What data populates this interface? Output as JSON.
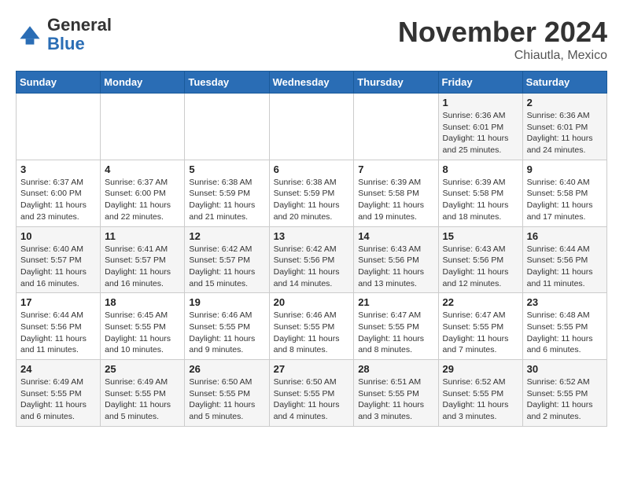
{
  "logo": {
    "general": "General",
    "blue": "Blue"
  },
  "header": {
    "month": "November 2024",
    "location": "Chiautla, Mexico"
  },
  "weekdays": [
    "Sunday",
    "Monday",
    "Tuesday",
    "Wednesday",
    "Thursday",
    "Friday",
    "Saturday"
  ],
  "weeks": [
    [
      {
        "day": "",
        "info": ""
      },
      {
        "day": "",
        "info": ""
      },
      {
        "day": "",
        "info": ""
      },
      {
        "day": "",
        "info": ""
      },
      {
        "day": "",
        "info": ""
      },
      {
        "day": "1",
        "info": "Sunrise: 6:36 AM\nSunset: 6:01 PM\nDaylight: 11 hours\nand 25 minutes."
      },
      {
        "day": "2",
        "info": "Sunrise: 6:36 AM\nSunset: 6:01 PM\nDaylight: 11 hours\nand 24 minutes."
      }
    ],
    [
      {
        "day": "3",
        "info": "Sunrise: 6:37 AM\nSunset: 6:00 PM\nDaylight: 11 hours\nand 23 minutes."
      },
      {
        "day": "4",
        "info": "Sunrise: 6:37 AM\nSunset: 6:00 PM\nDaylight: 11 hours\nand 22 minutes."
      },
      {
        "day": "5",
        "info": "Sunrise: 6:38 AM\nSunset: 5:59 PM\nDaylight: 11 hours\nand 21 minutes."
      },
      {
        "day": "6",
        "info": "Sunrise: 6:38 AM\nSunset: 5:59 PM\nDaylight: 11 hours\nand 20 minutes."
      },
      {
        "day": "7",
        "info": "Sunrise: 6:39 AM\nSunset: 5:58 PM\nDaylight: 11 hours\nand 19 minutes."
      },
      {
        "day": "8",
        "info": "Sunrise: 6:39 AM\nSunset: 5:58 PM\nDaylight: 11 hours\nand 18 minutes."
      },
      {
        "day": "9",
        "info": "Sunrise: 6:40 AM\nSunset: 5:58 PM\nDaylight: 11 hours\nand 17 minutes."
      }
    ],
    [
      {
        "day": "10",
        "info": "Sunrise: 6:40 AM\nSunset: 5:57 PM\nDaylight: 11 hours\nand 16 minutes."
      },
      {
        "day": "11",
        "info": "Sunrise: 6:41 AM\nSunset: 5:57 PM\nDaylight: 11 hours\nand 16 minutes."
      },
      {
        "day": "12",
        "info": "Sunrise: 6:42 AM\nSunset: 5:57 PM\nDaylight: 11 hours\nand 15 minutes."
      },
      {
        "day": "13",
        "info": "Sunrise: 6:42 AM\nSunset: 5:56 PM\nDaylight: 11 hours\nand 14 minutes."
      },
      {
        "day": "14",
        "info": "Sunrise: 6:43 AM\nSunset: 5:56 PM\nDaylight: 11 hours\nand 13 minutes."
      },
      {
        "day": "15",
        "info": "Sunrise: 6:43 AM\nSunset: 5:56 PM\nDaylight: 11 hours\nand 12 minutes."
      },
      {
        "day": "16",
        "info": "Sunrise: 6:44 AM\nSunset: 5:56 PM\nDaylight: 11 hours\nand 11 minutes."
      }
    ],
    [
      {
        "day": "17",
        "info": "Sunrise: 6:44 AM\nSunset: 5:56 PM\nDaylight: 11 hours\nand 11 minutes."
      },
      {
        "day": "18",
        "info": "Sunrise: 6:45 AM\nSunset: 5:55 PM\nDaylight: 11 hours\nand 10 minutes."
      },
      {
        "day": "19",
        "info": "Sunrise: 6:46 AM\nSunset: 5:55 PM\nDaylight: 11 hours\nand 9 minutes."
      },
      {
        "day": "20",
        "info": "Sunrise: 6:46 AM\nSunset: 5:55 PM\nDaylight: 11 hours\nand 8 minutes."
      },
      {
        "day": "21",
        "info": "Sunrise: 6:47 AM\nSunset: 5:55 PM\nDaylight: 11 hours\nand 8 minutes."
      },
      {
        "day": "22",
        "info": "Sunrise: 6:47 AM\nSunset: 5:55 PM\nDaylight: 11 hours\nand 7 minutes."
      },
      {
        "day": "23",
        "info": "Sunrise: 6:48 AM\nSunset: 5:55 PM\nDaylight: 11 hours\nand 6 minutes."
      }
    ],
    [
      {
        "day": "24",
        "info": "Sunrise: 6:49 AM\nSunset: 5:55 PM\nDaylight: 11 hours\nand 6 minutes."
      },
      {
        "day": "25",
        "info": "Sunrise: 6:49 AM\nSunset: 5:55 PM\nDaylight: 11 hours\nand 5 minutes."
      },
      {
        "day": "26",
        "info": "Sunrise: 6:50 AM\nSunset: 5:55 PM\nDaylight: 11 hours\nand 5 minutes."
      },
      {
        "day": "27",
        "info": "Sunrise: 6:50 AM\nSunset: 5:55 PM\nDaylight: 11 hours\nand 4 minutes."
      },
      {
        "day": "28",
        "info": "Sunrise: 6:51 AM\nSunset: 5:55 PM\nDaylight: 11 hours\nand 3 minutes."
      },
      {
        "day": "29",
        "info": "Sunrise: 6:52 AM\nSunset: 5:55 PM\nDaylight: 11 hours\nand 3 minutes."
      },
      {
        "day": "30",
        "info": "Sunrise: 6:52 AM\nSunset: 5:55 PM\nDaylight: 11 hours\nand 2 minutes."
      }
    ]
  ]
}
